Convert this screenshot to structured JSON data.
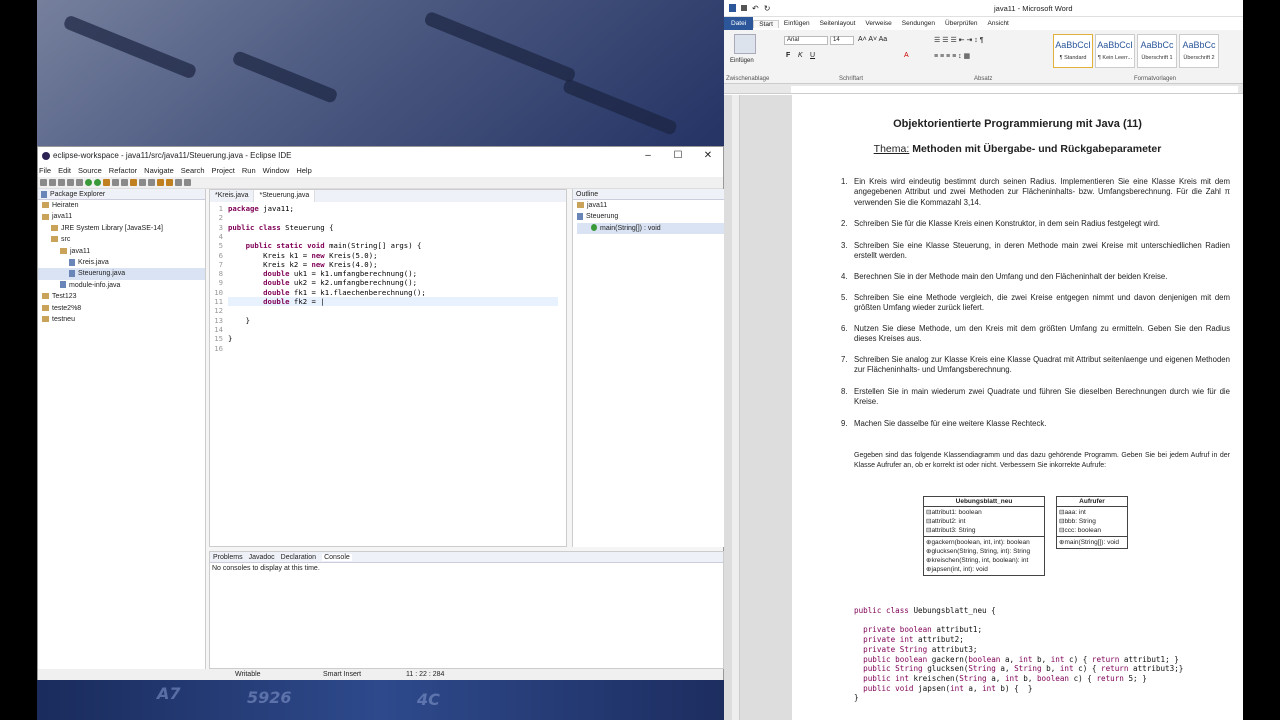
{
  "eclipse": {
    "title": "eclipse-workspace - java11/src/java11/Steuerung.java - Eclipse IDE",
    "menu": [
      "File",
      "Edit",
      "Source",
      "Refactor",
      "Navigate",
      "Search",
      "Project",
      "Run",
      "Window",
      "Help"
    ],
    "package_explorer": {
      "title": "Package Explorer",
      "items": [
        {
          "label": "Heiraten",
          "indent": 0
        },
        {
          "label": "java11",
          "indent": 0
        },
        {
          "label": "JRE System Library [JavaSE-14]",
          "indent": 1
        },
        {
          "label": "src",
          "indent": 1
        },
        {
          "label": "java11",
          "indent": 2
        },
        {
          "label": "Kreis.java",
          "indent": 3
        },
        {
          "label": "Steuerung.java",
          "indent": 3
        },
        {
          "label": "module-info.java",
          "indent": 2
        },
        {
          "label": "Test123",
          "indent": 0
        },
        {
          "label": "teste2%8",
          "indent": 0
        },
        {
          "label": "testneu",
          "indent": 0
        }
      ]
    },
    "editor_tabs": [
      "*Kreis.java",
      "*Steuerung.java"
    ],
    "code_lines": [
      {
        "n": "1",
        "text": "package java11;"
      },
      {
        "n": "2",
        "text": ""
      },
      {
        "n": "3",
        "text": "public class Steuerung {"
      },
      {
        "n": "4",
        "text": ""
      },
      {
        "n": "5",
        "text": "    public static void main(String[] args) {"
      },
      {
        "n": "6",
        "text": "        Kreis k1 = new Kreis(5.0);"
      },
      {
        "n": "7",
        "text": "        Kreis k2 = new Kreis(4.0);"
      },
      {
        "n": "8",
        "text": "        double uk1 = k1.umfangberechnung();"
      },
      {
        "n": "9",
        "text": "        double uk2 = k2.umfangberechnung();"
      },
      {
        "n": "10",
        "text": "        double fk1 = k1.flaechenberechnung();"
      },
      {
        "n": "11",
        "text": "        double fk2 = |"
      },
      {
        "n": "12",
        "text": ""
      },
      {
        "n": "13",
        "text": "    }"
      },
      {
        "n": "14",
        "text": ""
      },
      {
        "n": "15",
        "text": "}"
      },
      {
        "n": "16",
        "text": ""
      }
    ],
    "outline": {
      "title": "Outline",
      "items": [
        "java11",
        "Steuerung",
        "main(String[]) : void"
      ]
    },
    "console_tabs": [
      "Problems",
      "Javadoc",
      "Declaration",
      "Console"
    ],
    "console_text": "No consoles to display at this time.",
    "status": {
      "writable": "Writable",
      "insert": "Smart Insert",
      "pos": "11 : 22 : 284"
    }
  },
  "word": {
    "title": "java11 - Microsoft Word",
    "tabs": [
      "Datei",
      "Start",
      "Einfügen",
      "Seitenlayout",
      "Verweise",
      "Sendungen",
      "Überprüfen",
      "Ansicht"
    ],
    "ribbon": {
      "paste": "Einfügen",
      "font": "Arial",
      "size": "14",
      "groups": [
        "Zwischenablage",
        "Schriftart",
        "Absatz",
        "Formatvorlagen"
      ],
      "styles": [
        {
          "sample": "AaBbCcI",
          "name": "¶ Standard"
        },
        {
          "sample": "AaBbCcI",
          "name": "¶ Kein Leerr..."
        },
        {
          "sample": "AaBbCc",
          "name": "Überschrift 1"
        },
        {
          "sample": "AaBbCc",
          "name": "Überschrift 2"
        }
      ]
    },
    "doc": {
      "title": "Objektorientierte Programmierung mit Java (11)",
      "theme_label": "Thema:",
      "theme": "Methoden mit Übergabe- und Rückgabeparameter",
      "tasks": [
        {
          "n": "1.",
          "text": "Ein Kreis wird eindeutig bestimmt durch seinen Radius. Implementieren Sie eine Klasse Kreis mit dem angegebenen Attribut und zwei Methoden zur Flächeninhalts- bzw. Umfangsberechnung. Für die Zahl π verwenden Sie die Kommazahl 3,14."
        },
        {
          "n": "2.",
          "text": "Schreiben Sie für die Klasse Kreis einen Konstruktor, in dem sein Radius festgelegt wird."
        },
        {
          "n": "3.",
          "text": "Schreiben Sie eine Klasse Steuerung, in deren Methode main zwei Kreise mit unterschiedlichen Radien erstellt werden."
        },
        {
          "n": "4.",
          "text": "Berechnen Sie in der Methode main den Umfang und den Flächeninhalt der beiden Kreise."
        },
        {
          "n": "5.",
          "text": "Schreiben Sie eine Methode vergleich, die zwei Kreise entgegen nimmt und davon denjenigen mit dem größten Umfang wieder zurück liefert."
        },
        {
          "n": "6.",
          "text": "Nutzen Sie diese Methode, um den Kreis mit dem größten Umfang zu ermitteln. Geben Sie den Radius dieses Kreises aus."
        },
        {
          "n": "7.",
          "text": "Schreiben Sie analog zur Klasse Kreis eine Klasse Quadrat mit Attribut seitenlaenge und eigenen Methoden zur Flächeninhalts- und Umfangsberechnung."
        },
        {
          "n": "8.",
          "text": "Erstellen Sie in main wiederum zwei Quadrate und führen Sie dieselben Berechnungen durch wie für die Kreise."
        },
        {
          "n": "9.",
          "text": "Machen Sie dasselbe für eine weitere Klasse Rechteck."
        }
      ],
      "intro": "Gegeben sind das folgende Klassendiagramm und das dazu gehörende Programm. Geben Sie bei jedem Aufruf in der Klasse Aufrufer an, ob er korrekt ist oder nicht. Verbessern Sie inkorrekte Aufrufe:",
      "uml1": {
        "name": "Uebungsblatt_neu",
        "attrs": [
          "⊟attribut1: boolean",
          "⊟attribut2: int",
          "⊟attribut3: String"
        ],
        "methods": [
          "⊕gackern(boolean, int, int): boolean",
          "⊕glucksen(String, String, int): String",
          "⊕kreischen(String, int, boolean): int",
          "⊕japsen(int, int): void"
        ]
      },
      "uml2": {
        "name": "Aufrufer",
        "attrs": [
          "⊟aaa: int",
          "⊟bbb: String",
          "⊟ccc: boolean"
        ],
        "methods": [
          "⊕main(String[]): void"
        ]
      },
      "java": [
        "public class Uebungsblatt_neu {",
        "",
        "  private boolean attribut1;",
        "  private int attribut2;",
        "  private String attribut3;",
        "  public boolean gackern(boolean a, int b, int c) { return attribut1; }",
        "  public String glucksen(String a, String b, int c) { return attribut3;}",
        "  public int kreischen(String a, int b, boolean c) { return 5; }",
        "  public void japsen(int a, int b) {  }",
        "}"
      ]
    }
  }
}
